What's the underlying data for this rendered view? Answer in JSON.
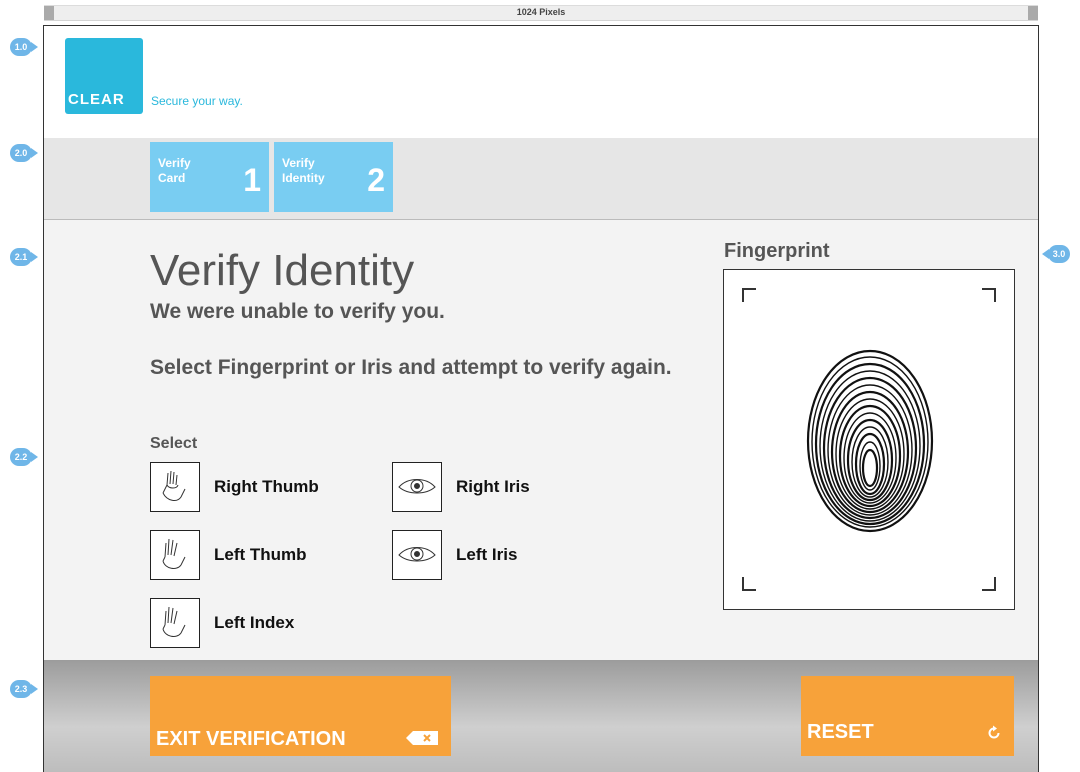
{
  "ruler": {
    "label": "1024 Pixels"
  },
  "annotations": [
    "1.0",
    "2.0",
    "2.1",
    "2.2",
    "2.3",
    "3.0"
  ],
  "header": {
    "logo_text": "CLEAR",
    "tagline": "Secure your way."
  },
  "steps": [
    {
      "label_line1": "Verify",
      "label_line2": "Card",
      "number": "1"
    },
    {
      "label_line1": "Verify",
      "label_line2": "Identity",
      "number": "2"
    }
  ],
  "main": {
    "title": "Verify Identity",
    "subtitle": "We were unable to verify you.",
    "instruction": "Select Fingerprint or Iris and attempt to verify again.",
    "select_label": "Select",
    "options": [
      {
        "label": "Right Thumb",
        "icon": "hand-icon"
      },
      {
        "label": "Left Thumb",
        "icon": "hand-icon"
      },
      {
        "label": "Left Index",
        "icon": "hand-icon"
      },
      {
        "label": "Right Iris",
        "icon": "eye-icon"
      },
      {
        "label": "Left Iris",
        "icon": "eye-icon"
      }
    ]
  },
  "fingerprint": {
    "title": "Fingerprint"
  },
  "footer": {
    "exit_label": "EXIT VERIFICATION",
    "reset_label": "RESET"
  },
  "colors": {
    "brand": "#2ab8dc",
    "step": "#79cdf2",
    "button": "#f7a23a",
    "annotation": "#6fb6e8"
  }
}
